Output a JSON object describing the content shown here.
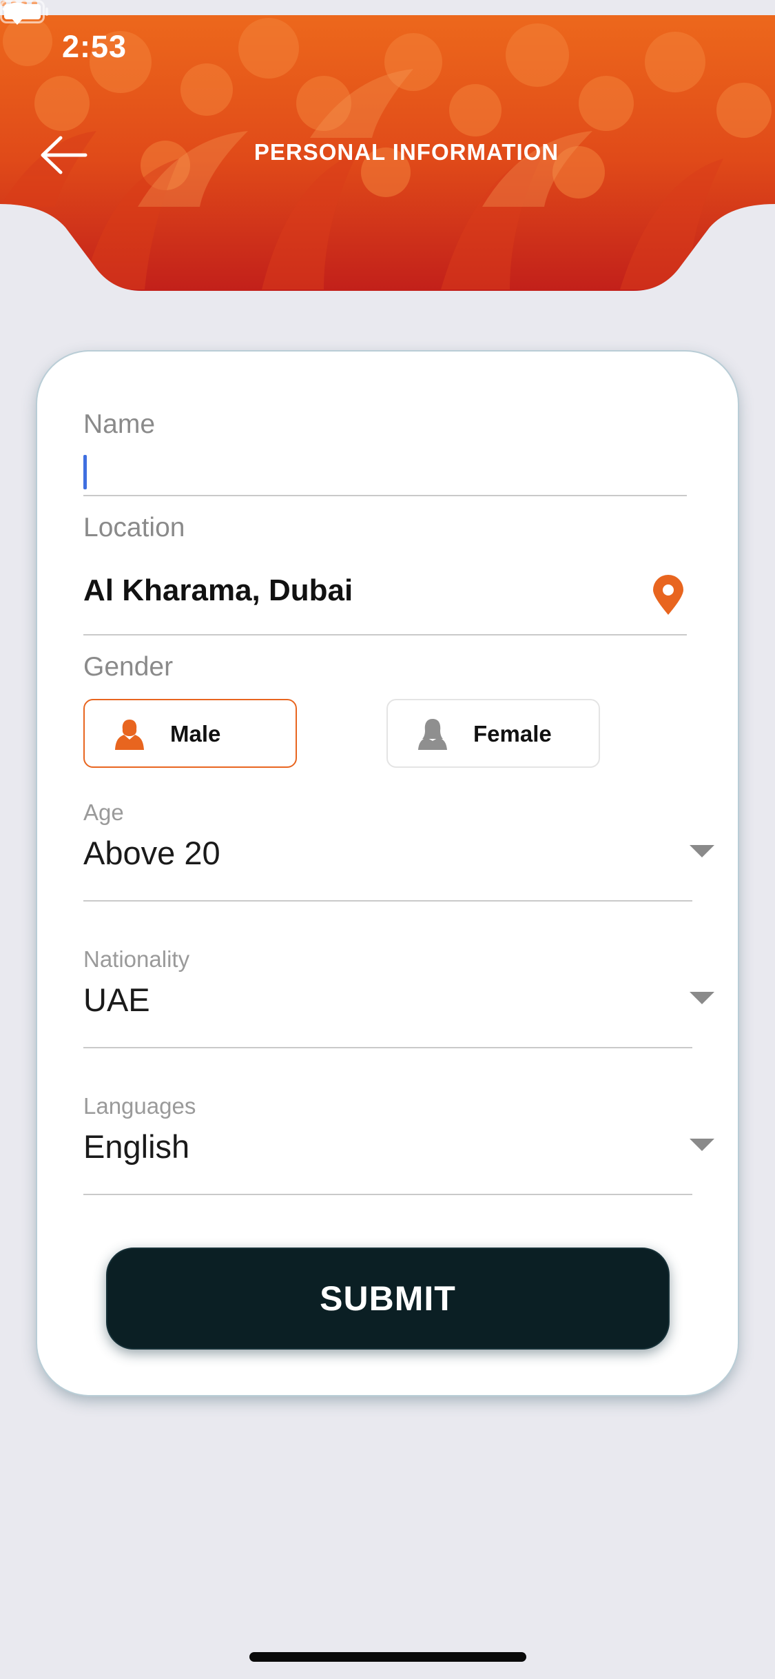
{
  "status_bar": {
    "time": "2:53",
    "signal_icon": "cellular-signal-icon",
    "wifi_icon": "wifi-icon",
    "battery_icon": "battery-icon"
  },
  "header": {
    "title": "PERSONAL INFORMATION",
    "back_icon": "arrow-left-icon",
    "colors": {
      "primary": "#e8651f",
      "secondary": "#c92418"
    }
  },
  "form": {
    "name": {
      "label": "Name",
      "value": "",
      "placeholder": ""
    },
    "location": {
      "label": "Location",
      "value": "Al Kharama, Dubai",
      "icon": "location-pin-icon"
    },
    "gender": {
      "label": "Gender",
      "options": [
        {
          "label": "Male",
          "selected": true,
          "icon": "male-person-icon"
        },
        {
          "label": "Female",
          "selected": false,
          "icon": "female-person-icon"
        }
      ]
    },
    "age": {
      "label": "Age",
      "value": "Above 20"
    },
    "nationality": {
      "label": "Nationality",
      "value": "UAE"
    },
    "languages": {
      "label": "Languages",
      "value": "English"
    },
    "submit_label": "SUBMIT"
  },
  "theme": {
    "accent": "#e8651f",
    "button_bg": "#0b1f24",
    "caret": "#3f6fe0",
    "background": "#e9e9ef"
  }
}
